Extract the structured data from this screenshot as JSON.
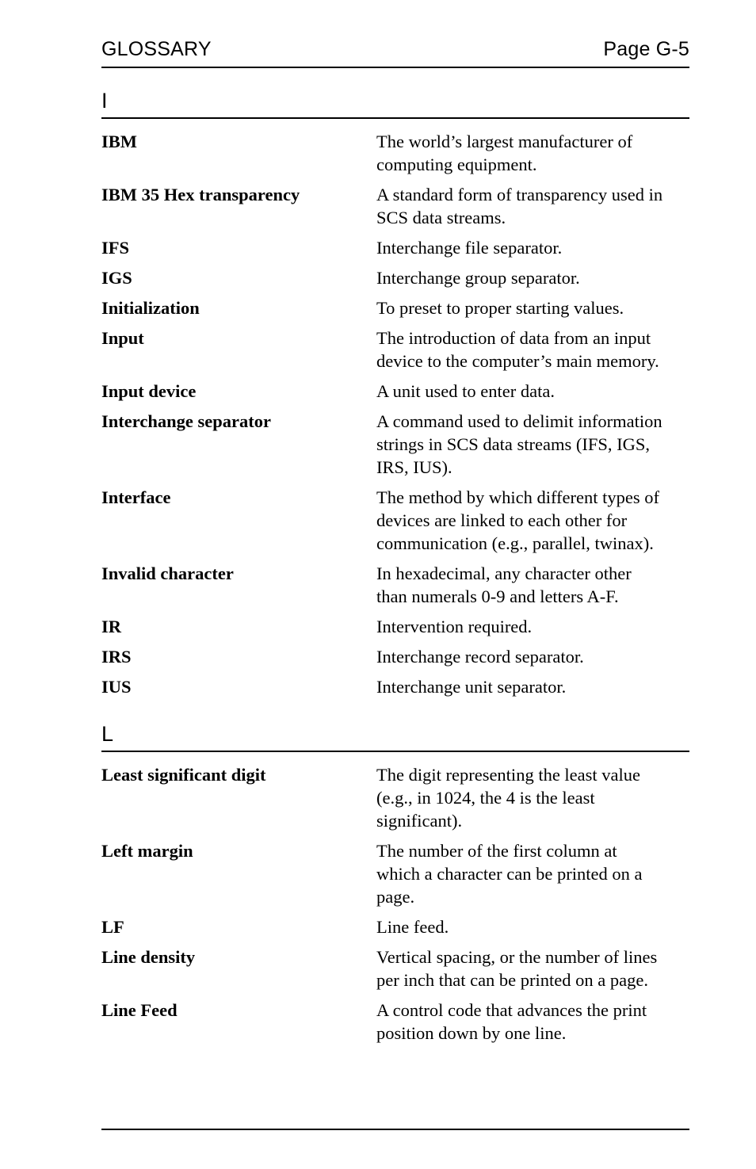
{
  "header": {
    "title": "GLOSSARY",
    "page_label": "Page G-5"
  },
  "sections": [
    {
      "letter": "I",
      "entries": [
        {
          "term": "IBM",
          "definition": "The world’s largest manufacturer of computing equipment.",
          "lines": [
            "The world’s largest manufacturer of",
            "computing equipment."
          ]
        },
        {
          "term": "IBM 35 Hex transparency",
          "definition": "A standard form of transparency used in SCS data streams.",
          "lines": [
            "A standard form of transparency used in",
            "SCS data streams."
          ]
        },
        {
          "term": "IFS",
          "definition": "Interchange file separator.",
          "lines": [
            "Interchange file separator."
          ]
        },
        {
          "term": "IGS",
          "definition": "Interchange group separator.",
          "lines": [
            "Interchange group separator."
          ]
        },
        {
          "term": "Initialization",
          "definition": "To preset to proper starting values.",
          "lines": [
            "To preset to proper starting values."
          ]
        },
        {
          "term": "Input",
          "definition": "The introduction of data from an input device to the computer’s main memory.",
          "lines": [
            "The introduction of data from an input",
            "device to the computer’s main memory."
          ]
        },
        {
          "term": "Input device",
          "definition": "A unit used to enter data.",
          "lines": [
            "A unit used to enter data."
          ]
        },
        {
          "term": "Interchange separator",
          "definition": "A command used to delimit information strings in SCS data streams (IFS, IGS, IRS, IUS).",
          "lines": [
            "A command used to delimit information",
            "strings in SCS data streams (IFS, IGS,",
            "IRS, IUS)."
          ]
        },
        {
          "term": "Interface",
          "definition": "The method by which different types of devices are linked to each other for communication (e.g., parallel, twinax).",
          "lines": [
            "The method by which different types of",
            "devices are linked to each other for",
            "communication (e.g., parallel, twinax)."
          ]
        },
        {
          "term": "Invalid character",
          "definition": "In hexadecimal, any character other than numerals 0-9 and letters A-F.",
          "lines": [
            "In hexadecimal, any character other",
            "than numerals 0-9 and letters A-F."
          ]
        },
        {
          "term": "IR",
          "definition": "Intervention required.",
          "lines": [
            "Intervention required."
          ]
        },
        {
          "term": "IRS",
          "definition": "Interchange record separator.",
          "lines": [
            "Interchange record separator."
          ]
        },
        {
          "term": "IUS",
          "definition": "Interchange unit separator.",
          "lines": [
            "Interchange unit separator."
          ]
        }
      ]
    },
    {
      "letter": "L",
      "entries": [
        {
          "term": "Least significant digit",
          "definition": "The digit representing the least value (e.g., in 1024, the 4 is the least significant).",
          "lines": [
            "The digit representing the least value",
            "(e.g., in 1024, the 4 is the least",
            "significant)."
          ]
        },
        {
          "term": "Left margin",
          "definition": "The number of the first column at which a character can be printed on a page.",
          "lines": [
            "The number of the first column at",
            "which a character can be printed on a",
            "page."
          ]
        },
        {
          "term": "LF",
          "definition": "Line feed.",
          "lines": [
            "Line feed."
          ]
        },
        {
          "term": "Line density",
          "definition": "Vertical spacing, or the number of lines per inch that can be printed on a page.",
          "lines": [
            "Vertical spacing, or the number of lines",
            "per inch that can be printed on a page."
          ]
        },
        {
          "term": "Line Feed",
          "definition": "A control code that advances the print position down by one line.",
          "lines": [
            "A control code that advances the print",
            "position down by one line."
          ]
        }
      ]
    }
  ]
}
